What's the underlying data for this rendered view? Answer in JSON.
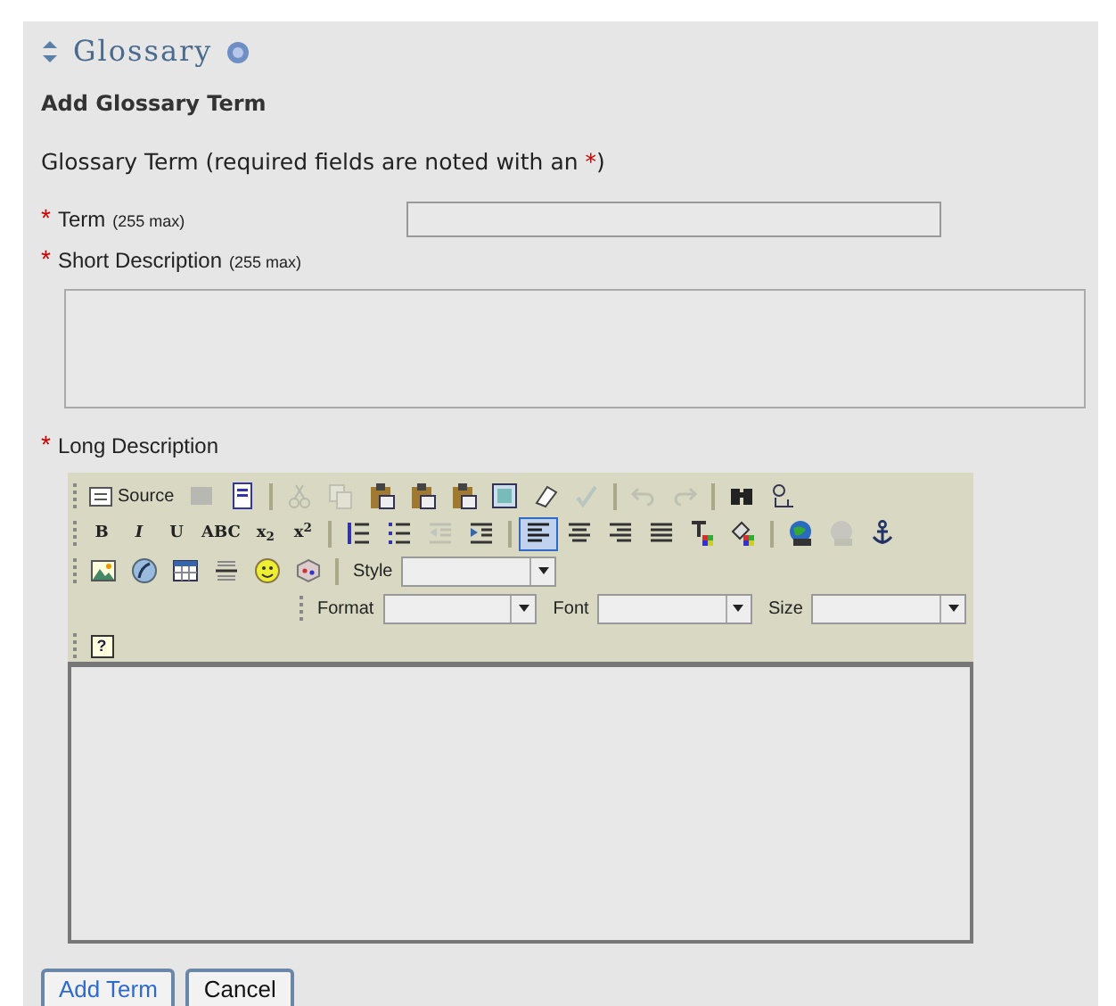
{
  "page_title": "Glossary",
  "heading": "Add Glossary Term",
  "required_mark": "*",
  "intro": [
    "Glossary Term (required fields are noted with an ",
    "*",
    ")"
  ],
  "fields": [
    {
      "kind": "input",
      "required": true,
      "label": "Term",
      "hint": "(255 max)"
    },
    {
      "kind": "textarea",
      "required": true,
      "label": "Short Description",
      "hint": "(255 max)"
    },
    {
      "kind": "editor",
      "required": true,
      "label": "Long Description"
    }
  ],
  "toolbar_rows": [
    [
      {
        "kind": "source",
        "label": "Source",
        "disabled": false,
        "selected": false
      },
      {
        "kind": "save",
        "disabled": true,
        "selected": false
      },
      {
        "kind": "page",
        "disabled": false,
        "selected": false
      },
      {
        "kind": "sep"
      },
      {
        "kind": "cut",
        "disabled": true,
        "selected": false
      },
      {
        "kind": "copy",
        "disabled": true,
        "selected": false
      },
      {
        "kind": "paste",
        "disabled": false,
        "selected": false
      },
      {
        "kind": "paste",
        "disabled": false,
        "selected": false
      },
      {
        "kind": "paste",
        "disabled": false,
        "selected": false
      },
      {
        "kind": "selectall",
        "disabled": false,
        "selected": false
      },
      {
        "kind": "eraser",
        "disabled": false,
        "selected": false
      },
      {
        "kind": "check",
        "disabled": true,
        "selected": false
      },
      {
        "kind": "sep"
      },
      {
        "kind": "undo",
        "disabled": true,
        "selected": false
      },
      {
        "kind": "redo",
        "disabled": true,
        "selected": false
      },
      {
        "kind": "sep"
      },
      {
        "kind": "find",
        "disabled": false,
        "selected": false
      },
      {
        "kind": "replace",
        "disabled": false,
        "selected": false
      }
    ],
    [
      {
        "kind": "glyph",
        "label": "B",
        "disabled": false,
        "selected": false
      },
      {
        "kind": "glyph",
        "label": "I",
        "disabled": false,
        "selected": false
      },
      {
        "kind": "glyph",
        "label": "U",
        "disabled": false,
        "selected": false
      },
      {
        "kind": "glyph",
        "label": "ABC",
        "disabled": false,
        "selected": false
      },
      {
        "kind": "glyph",
        "label": "x$_{2}$",
        "disabled": false,
        "selected": false
      },
      {
        "kind": "glyph",
        "label": "x$^{2}$",
        "disabled": false,
        "selected": false
      },
      {
        "kind": "sep"
      },
      {
        "kind": "olist",
        "disabled": false,
        "selected": false
      },
      {
        "kind": "ulist",
        "disabled": false,
        "selected": false
      },
      {
        "kind": "outdent",
        "disabled": true,
        "selected": false
      },
      {
        "kind": "indent",
        "disabled": false,
        "selected": false
      },
      {
        "kind": "sep"
      },
      {
        "kind": "left",
        "disabled": false,
        "selected": true
      },
      {
        "kind": "center",
        "disabled": false,
        "selected": false
      },
      {
        "kind": "right",
        "disabled": false,
        "selected": false
      },
      {
        "kind": "justify",
        "disabled": false,
        "selected": false
      },
      {
        "kind": "textcolor",
        "disabled": false,
        "selected": false
      },
      {
        "kind": "bgcolor",
        "disabled": false,
        "selected": false
      },
      {
        "kind": "sep"
      },
      {
        "kind": "link",
        "disabled": false,
        "selected": false
      },
      {
        "kind": "unlink",
        "disabled": true,
        "selected": false
      },
      {
        "kind": "anchor",
        "disabled": false,
        "selected": false
      }
    ],
    [
      {
        "kind": "image",
        "disabled": false,
        "selected": false
      },
      {
        "kind": "flash",
        "disabled": false,
        "selected": false
      },
      {
        "kind": "table",
        "disabled": false,
        "selected": false
      },
      {
        "kind": "hr",
        "disabled": false,
        "selected": false
      },
      {
        "kind": "smiley",
        "disabled": false,
        "selected": false
      },
      {
        "kind": "special",
        "disabled": false,
        "selected": false
      },
      {
        "kind": "sep"
      },
      {
        "kind": "combo",
        "label": "Style"
      }
    ],
    [
      {
        "kind": "combo",
        "label": "Format"
      },
      {
        "kind": "combo",
        "label": "Font"
      },
      {
        "kind": "combo",
        "label": "Size"
      }
    ],
    [
      {
        "kind": "help",
        "label": "?",
        "disabled": false,
        "selected": false
      }
    ]
  ],
  "buttons": [
    {
      "label": "Add Term",
      "primary": true
    },
    {
      "label": "Cancel",
      "primary": false
    }
  ]
}
